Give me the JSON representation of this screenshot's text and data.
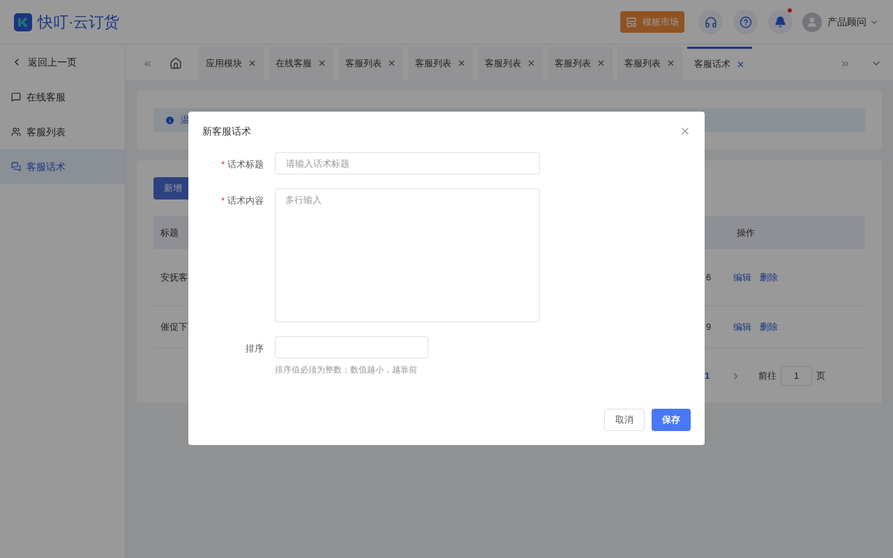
{
  "header": {
    "logo_text": "快叮·云订货",
    "template_button": "模板市场",
    "notifications_unread": true,
    "user_name": "产品顾问"
  },
  "sidebar": {
    "back": "返回上一页",
    "items": [
      {
        "label": "在线客服",
        "kind": "chat",
        "selected": false
      },
      {
        "label": "客服列表",
        "kind": "users",
        "selected": false
      },
      {
        "label": "客服话术",
        "kind": "talk",
        "selected": true
      }
    ]
  },
  "tabs": [
    {
      "label": "应用模块",
      "selected": false
    },
    {
      "label": "在线客服",
      "selected": false
    },
    {
      "label": "客服列表",
      "selected": false
    },
    {
      "label": "客服列表",
      "selected": false
    },
    {
      "label": "客服列表",
      "selected": false
    },
    {
      "label": "客服列表",
      "selected": false
    },
    {
      "label": "客服列表",
      "selected": false
    },
    {
      "label": "客服话术",
      "selected": true
    }
  ],
  "page": {
    "alert_text": "温",
    "add_button": "新增",
    "table": {
      "columns": [
        "标题",
        "操作"
      ],
      "rows": [
        {
          "title": "安抚客",
          "column_2": "6",
          "actions": [
            "编辑",
            "删除"
          ]
        },
        {
          "title": "催促下",
          "column_2": "9",
          "actions": [
            "编辑",
            "删除"
          ]
        }
      ]
    },
    "pagination": {
      "current_page": "1",
      "goto_label": "前往",
      "goto_value": "1",
      "page_suffix": "页"
    }
  },
  "dialog": {
    "title": "新客服话术",
    "fields": [
      {
        "kind": "input",
        "label": "话术标题",
        "required_mark": "*",
        "placeholder": "请输入话术标题"
      },
      {
        "kind": "textarea",
        "label": "话术内容",
        "required_mark": "*",
        "placeholder": "多行输入"
      },
      {
        "kind": "short_input",
        "label": "排序",
        "hint": "排序值必须为整数；数值越小，越靠前"
      }
    ],
    "cancel_button": "取消",
    "save_button": "保存"
  }
}
